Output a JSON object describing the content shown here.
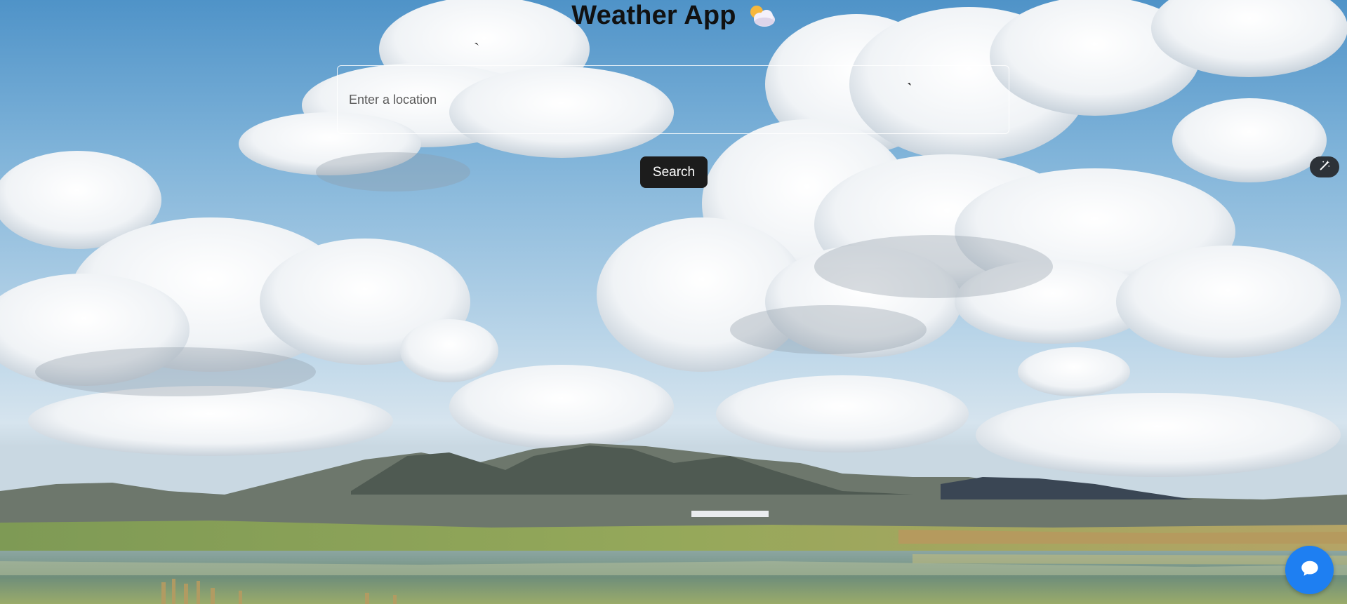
{
  "header": {
    "title": "Weather App",
    "icon": "sun-behind-cloud-icon"
  },
  "search": {
    "placeholder": "Enter a location",
    "value": "",
    "button_label": "Search"
  },
  "floating": {
    "magic_icon": "magic-wand-icon",
    "chat_icon": "chat-bubble-icon",
    "chat_color": "#1e7ff2"
  },
  "colors": {
    "button_bg": "#1c1c1c",
    "title_color": "#111111"
  }
}
